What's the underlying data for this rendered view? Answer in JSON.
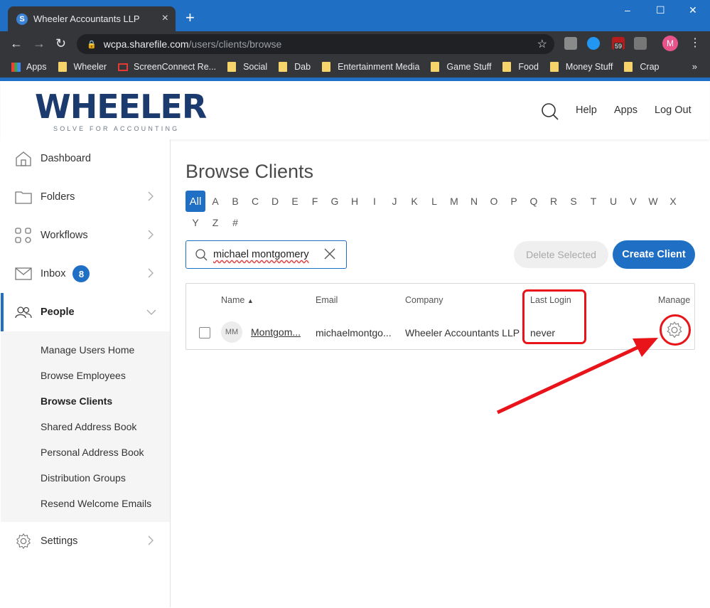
{
  "browser": {
    "tab_title": "Wheeler Accountants LLP",
    "tab_favicon": "S",
    "new_tab": "+",
    "url_host": "wcpa.sharefile.com",
    "url_path": "/users/clients/browse",
    "profile_initial": "M",
    "ext_badge": "59",
    "window_controls": [
      "–",
      "☐",
      "✕"
    ],
    "bookmarks": [
      {
        "label": "Apps",
        "icon": "apps-grid-icon"
      },
      {
        "label": "Wheeler",
        "icon": "folder-icon"
      },
      {
        "label": "ScreenConnect Re...",
        "icon": "screenconnect-icon"
      },
      {
        "label": "Social",
        "icon": "folder-icon"
      },
      {
        "label": "Dab",
        "icon": "folder-icon"
      },
      {
        "label": "Entertainment Media",
        "icon": "folder-icon"
      },
      {
        "label": "Game Stuff",
        "icon": "folder-icon"
      },
      {
        "label": "Food",
        "icon": "folder-icon"
      },
      {
        "label": "Money Stuff",
        "icon": "folder-icon"
      },
      {
        "label": "Crap",
        "icon": "folder-icon"
      }
    ],
    "bookmarks_more": "»"
  },
  "header": {
    "logo_text": "WHEELER",
    "logo_tagline": "SOLVE FOR ACCOUNTING",
    "links": [
      "Help",
      "Apps",
      "Log Out"
    ]
  },
  "sidebar": {
    "items": [
      {
        "label": "Dashboard"
      },
      {
        "label": "Folders"
      },
      {
        "label": "Workflows"
      },
      {
        "label": "Inbox",
        "badge": "8"
      },
      {
        "label": "People"
      },
      {
        "label": "Settings"
      }
    ],
    "people_sub": [
      "Manage Users Home",
      "Browse Employees",
      "Browse Clients",
      "Shared Address Book",
      "Personal Address Book",
      "Distribution Groups",
      "Resend Welcome Emails"
    ]
  },
  "main": {
    "title": "Browse Clients",
    "letters": [
      "All",
      "A",
      "B",
      "C",
      "D",
      "E",
      "F",
      "G",
      "H",
      "I",
      "J",
      "K",
      "L",
      "M",
      "N",
      "O",
      "P",
      "Q",
      "R",
      "S",
      "T",
      "U",
      "V",
      "W",
      "X",
      "Y",
      "Z",
      "#"
    ],
    "search_value": "michael montgomery",
    "delete_label": "Delete Selected",
    "create_label": "Create Client",
    "table": {
      "headers": {
        "name": "Name",
        "sort": "▲",
        "email": "Email",
        "company": "Company",
        "last_login": "Last Login",
        "manage": "Manage"
      },
      "row": {
        "initials": "MM",
        "name": "Montgom...",
        "email": "michaelmontgo...",
        "company": "Wheeler Accountants LLP",
        "last_login": "never"
      }
    }
  },
  "colors": {
    "accent": "#1f6fc5",
    "annotation": "#e8141a",
    "logo": "#1b3b6f"
  }
}
